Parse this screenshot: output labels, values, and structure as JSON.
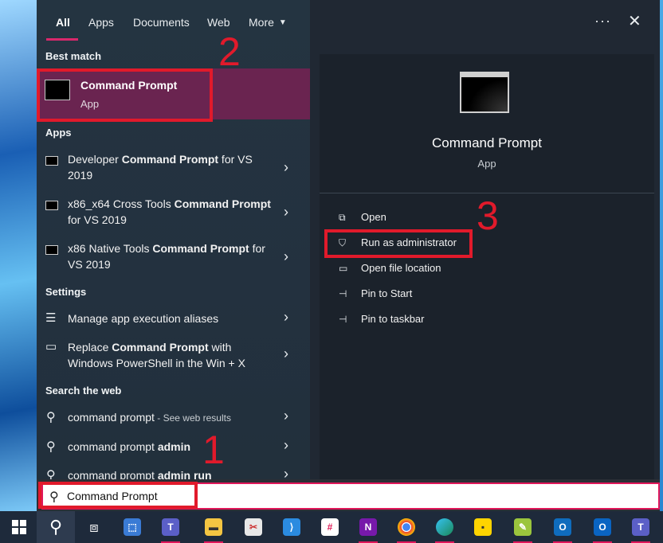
{
  "tabs": [
    {
      "label": "All",
      "active": true
    },
    {
      "label": "Apps"
    },
    {
      "label": "Documents"
    },
    {
      "label": "Web"
    },
    {
      "label": "More"
    }
  ],
  "top_actions": {
    "more_options": "···",
    "close": "✕"
  },
  "best_match": {
    "section": "Best match",
    "title": "Command Prompt",
    "subtitle": "App"
  },
  "apps": {
    "section": "Apps",
    "items": [
      {
        "pre": "Developer ",
        "bold": "Command Prompt",
        "post": " for VS 2019"
      },
      {
        "pre": "x86_x64 Cross Tools ",
        "bold": "Command Prompt",
        "post": " for VS 2019"
      },
      {
        "pre": "x86 Native Tools ",
        "bold": "Command Prompt",
        "post": " for VS 2019"
      }
    ]
  },
  "settings": {
    "section": "Settings",
    "items": [
      {
        "pre": "Manage app execution aliases",
        "bold": "",
        "post": ""
      },
      {
        "pre": "Replace ",
        "bold": "Command Prompt",
        "post": " with Windows PowerShell in the Win + X"
      }
    ]
  },
  "web": {
    "section": "Search the web",
    "items": [
      {
        "pre": "command prompt",
        "bold": "",
        "post": "",
        "hint": " - See web results"
      },
      {
        "pre": "command prompt ",
        "bold": "admin",
        "post": "",
        "hint": ""
      },
      {
        "pre": "command prompt ",
        "bold": "admin run",
        "post": "",
        "hint": ""
      }
    ]
  },
  "detail": {
    "title": "Command Prompt",
    "subtitle": "App",
    "actions": [
      {
        "label": "Open",
        "icon": "open-icon"
      },
      {
        "label": "Run as administrator",
        "icon": "shield-icon"
      },
      {
        "label": "Open file location",
        "icon": "folder-icon"
      },
      {
        "label": "Pin to Start",
        "icon": "pin-icon"
      },
      {
        "label": "Pin to taskbar",
        "icon": "pin-icon"
      }
    ]
  },
  "search": {
    "value": "Command Prompt"
  },
  "annotations": [
    "1",
    "2",
    "3"
  ],
  "colors": {
    "accent": "#d9286c",
    "annotation": "#e11a2b",
    "best_match_bg": "#6a2450"
  },
  "taskbar": [
    "windows-start-icon",
    "search-icon",
    "task-view-icon",
    "store-icon",
    "teams-icon",
    "file-explorer-icon",
    "snipping-icon",
    "vscode-icon",
    "slack-icon",
    "onenote-icon",
    "chrome-icon",
    "edge-icon",
    "sticky-notes-icon",
    "notepad-icon",
    "outlook-new-icon",
    "outlook-icon",
    "teams-new-icon"
  ]
}
